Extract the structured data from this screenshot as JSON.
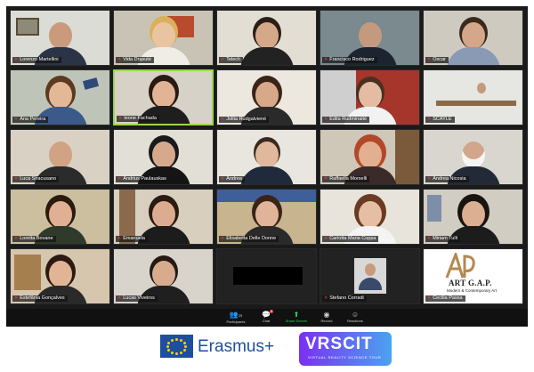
{
  "participants": [
    {
      "name": "Lorenzo Martellini"
    },
    {
      "name": "Vida Drąsutė"
    },
    {
      "name": "Telech"
    },
    {
      "name": "Francisco Rodriguez"
    },
    {
      "name": "Oscar"
    },
    {
      "name": "Ana Pereira"
    },
    {
      "name": "Ieone Fachada"
    },
    {
      "name": "Jolita Rudgalvienė"
    },
    {
      "name": "Edita Rudminaitė"
    },
    {
      "name": "SCAYLE"
    },
    {
      "name": "Luca Siracusano"
    },
    {
      "name": "Andrius Paulauskas"
    },
    {
      "name": "Andrea"
    },
    {
      "name": "Raffaella Morselli"
    },
    {
      "name": "Andrea Nicosia"
    },
    {
      "name": "Loretta Bovane"
    },
    {
      "name": "Emanuela"
    },
    {
      "name": "Elisabetta Delle Donne"
    },
    {
      "name": "Carlotta Maria Coppa"
    },
    {
      "name": "Miriam Tulli"
    },
    {
      "name": "Estefânia Gonçalves"
    },
    {
      "name": "Lucas Viveiros"
    },
    {
      "name": ""
    },
    {
      "name": "Stefano Corradi"
    },
    {
      "name": "Cecilia Passa"
    }
  ],
  "logo_tile": {
    "lettering": "AP",
    "name": "ART G.A.P.",
    "subtitle": "Modern & Contemporary Art"
  },
  "toolbar": {
    "participants_label": "Participants",
    "participants_count": "25",
    "chat_label": "Chat",
    "chat_badge": "9",
    "share_label": "Share Screen",
    "record_label": "Record",
    "reactions_label": "Reactions"
  },
  "footer": {
    "erasmus_text": "Erasmus+",
    "vrscit_text": "VRSCIT",
    "vrscit_subtitle": "VIRTUAL REALITY SCIENCE TOUR"
  },
  "colors": {
    "active_speaker_border": "#9cd64a",
    "mic_muted": "#ff3b3b",
    "erasmus_blue": "#1d4f9e",
    "share_green": "#2bd45b"
  }
}
